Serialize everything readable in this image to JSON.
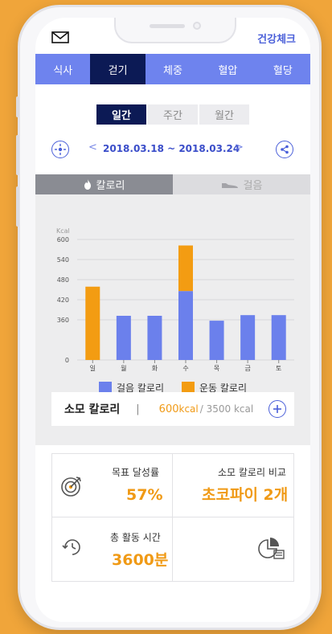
{
  "topbar": {
    "title": "건강체크",
    "mail_icon": "mail-icon"
  },
  "tabs": [
    {
      "label": "식사",
      "active": false
    },
    {
      "label": "걷기",
      "active": true
    },
    {
      "label": "체중",
      "active": false
    },
    {
      "label": "혈압",
      "active": false
    },
    {
      "label": "혈당",
      "active": false
    }
  ],
  "period": [
    {
      "label": "일간",
      "active": true
    },
    {
      "label": "주간",
      "active": false
    },
    {
      "label": "월간",
      "active": false
    }
  ],
  "date_range": {
    "prev": "<",
    "label": "2018.03.18 ~ 2018.03.24",
    "next": ">"
  },
  "metric_tabs": {
    "calorie_label": "칼로리",
    "steps_label": "걸음"
  },
  "chart_data": {
    "type": "bar",
    "stacked": true,
    "unit_label": "Kcal",
    "categories": [
      "일",
      "월",
      "화",
      "수",
      "목",
      "금",
      "토"
    ],
    "y_ticks": [
      0,
      360,
      420,
      480,
      540,
      600
    ],
    "ylim": [
      0,
      600
    ],
    "series": [
      {
        "name": "걸음 칼로리",
        "color": "#6b80ec",
        "values": [
          0,
          372,
          372,
          446,
          352,
          374,
          374
        ]
      },
      {
        "name": "운동 칼로리",
        "color": "#f39c12",
        "values": [
          459,
          0,
          0,
          136,
          0,
          0,
          0
        ]
      }
    ],
    "grid": true,
    "legend": "bottom"
  },
  "calorie_summary": {
    "title": "소모 칼로리",
    "separator": "|",
    "value": "600",
    "unit": "kcal",
    "total": "/ 3500 kcal"
  },
  "stats": {
    "goal_label": "목표 달성률",
    "goal_value": "57%",
    "compare_label": "소모 칼로리 비교",
    "compare_value": "초코파이 2개",
    "time_label": "총 활동 시간",
    "time_value": "3600분"
  },
  "colors": {
    "accent": "#6e83ee",
    "dark": "#0c1a55",
    "orange": "#f39c12",
    "blue_bar": "#6b80ec"
  }
}
